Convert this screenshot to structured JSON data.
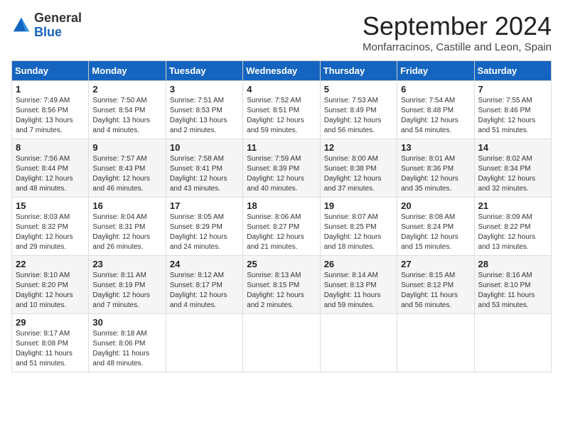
{
  "header": {
    "logo_line1": "General",
    "logo_line2": "Blue",
    "month": "September 2024",
    "location": "Monfarracinos, Castille and Leon, Spain"
  },
  "days_of_week": [
    "Sunday",
    "Monday",
    "Tuesday",
    "Wednesday",
    "Thursday",
    "Friday",
    "Saturday"
  ],
  "weeks": [
    [
      {
        "day": "1",
        "sunrise": "7:49 AM",
        "sunset": "8:56 PM",
        "daylight": "13 hours and 7 minutes."
      },
      {
        "day": "2",
        "sunrise": "7:50 AM",
        "sunset": "8:54 PM",
        "daylight": "13 hours and 4 minutes."
      },
      {
        "day": "3",
        "sunrise": "7:51 AM",
        "sunset": "8:53 PM",
        "daylight": "13 hours and 2 minutes."
      },
      {
        "day": "4",
        "sunrise": "7:52 AM",
        "sunset": "8:51 PM",
        "daylight": "12 hours and 59 minutes."
      },
      {
        "day": "5",
        "sunrise": "7:53 AM",
        "sunset": "8:49 PM",
        "daylight": "12 hours and 56 minutes."
      },
      {
        "day": "6",
        "sunrise": "7:54 AM",
        "sunset": "8:48 PM",
        "daylight": "12 hours and 54 minutes."
      },
      {
        "day": "7",
        "sunrise": "7:55 AM",
        "sunset": "8:46 PM",
        "daylight": "12 hours and 51 minutes."
      }
    ],
    [
      {
        "day": "8",
        "sunrise": "7:56 AM",
        "sunset": "8:44 PM",
        "daylight": "12 hours and 48 minutes."
      },
      {
        "day": "9",
        "sunrise": "7:57 AM",
        "sunset": "8:43 PM",
        "daylight": "12 hours and 46 minutes."
      },
      {
        "day": "10",
        "sunrise": "7:58 AM",
        "sunset": "8:41 PM",
        "daylight": "12 hours and 43 minutes."
      },
      {
        "day": "11",
        "sunrise": "7:59 AM",
        "sunset": "8:39 PM",
        "daylight": "12 hours and 40 minutes."
      },
      {
        "day": "12",
        "sunrise": "8:00 AM",
        "sunset": "8:38 PM",
        "daylight": "12 hours and 37 minutes."
      },
      {
        "day": "13",
        "sunrise": "8:01 AM",
        "sunset": "8:36 PM",
        "daylight": "12 hours and 35 minutes."
      },
      {
        "day": "14",
        "sunrise": "8:02 AM",
        "sunset": "8:34 PM",
        "daylight": "12 hours and 32 minutes."
      }
    ],
    [
      {
        "day": "15",
        "sunrise": "8:03 AM",
        "sunset": "8:32 PM",
        "daylight": "12 hours and 29 minutes."
      },
      {
        "day": "16",
        "sunrise": "8:04 AM",
        "sunset": "8:31 PM",
        "daylight": "12 hours and 26 minutes."
      },
      {
        "day": "17",
        "sunrise": "8:05 AM",
        "sunset": "8:29 PM",
        "daylight": "12 hours and 24 minutes."
      },
      {
        "day": "18",
        "sunrise": "8:06 AM",
        "sunset": "8:27 PM",
        "daylight": "12 hours and 21 minutes."
      },
      {
        "day": "19",
        "sunrise": "8:07 AM",
        "sunset": "8:25 PM",
        "daylight": "12 hours and 18 minutes."
      },
      {
        "day": "20",
        "sunrise": "8:08 AM",
        "sunset": "8:24 PM",
        "daylight": "12 hours and 15 minutes."
      },
      {
        "day": "21",
        "sunrise": "8:09 AM",
        "sunset": "8:22 PM",
        "daylight": "12 hours and 13 minutes."
      }
    ],
    [
      {
        "day": "22",
        "sunrise": "8:10 AM",
        "sunset": "8:20 PM",
        "daylight": "12 hours and 10 minutes."
      },
      {
        "day": "23",
        "sunrise": "8:11 AM",
        "sunset": "8:19 PM",
        "daylight": "12 hours and 7 minutes."
      },
      {
        "day": "24",
        "sunrise": "8:12 AM",
        "sunset": "8:17 PM",
        "daylight": "12 hours and 4 minutes."
      },
      {
        "day": "25",
        "sunrise": "8:13 AM",
        "sunset": "8:15 PM",
        "daylight": "12 hours and 2 minutes."
      },
      {
        "day": "26",
        "sunrise": "8:14 AM",
        "sunset": "8:13 PM",
        "daylight": "11 hours and 59 minutes."
      },
      {
        "day": "27",
        "sunrise": "8:15 AM",
        "sunset": "8:12 PM",
        "daylight": "11 hours and 56 minutes."
      },
      {
        "day": "28",
        "sunrise": "8:16 AM",
        "sunset": "8:10 PM",
        "daylight": "11 hours and 53 minutes."
      }
    ],
    [
      {
        "day": "29",
        "sunrise": "8:17 AM",
        "sunset": "8:08 PM",
        "daylight": "11 hours and 51 minutes."
      },
      {
        "day": "30",
        "sunrise": "8:18 AM",
        "sunset": "8:06 PM",
        "daylight": "11 hours and 48 minutes."
      },
      null,
      null,
      null,
      null,
      null
    ]
  ]
}
